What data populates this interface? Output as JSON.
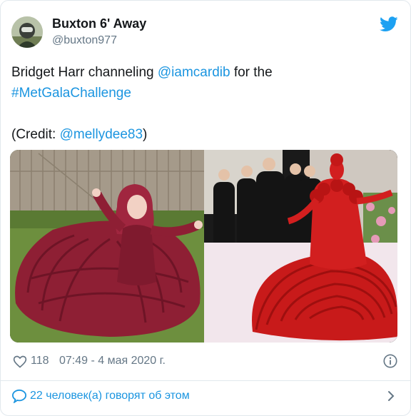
{
  "author": {
    "display_name": "Buxton 6' Away",
    "handle": "@buxton977",
    "avatar_icon": "avatar-photo"
  },
  "brand": {
    "icon": "twitter-bird-icon",
    "color": "#1da1f2"
  },
  "tweet": {
    "text_prefix": "Bridget Harr channeling ",
    "mention_1": "@iamcardib",
    "text_mid": " for the",
    "hashtag": "#MetGalaChallenge",
    "credit_prefix": "(Credit: ",
    "mention_2": "@mellydee83",
    "credit_suffix": ")"
  },
  "media": {
    "left_photo": "child-in-red-blanket-gown-photo",
    "right_photo": "red-carpet-red-gown-photo"
  },
  "meta": {
    "like_icon": "heart-icon",
    "like_count": "118",
    "timestamp": "07:49 - 4 мая 2020 г.",
    "info_icon": "info-icon"
  },
  "footer": {
    "reply_icon": "speech-bubble-icon",
    "text": "22 человек(а) говорят об этом",
    "chevron_icon": "chevron-right-icon"
  },
  "colors": {
    "link": "#1b95e0",
    "secondary_text": "#657786",
    "border": "#e1e8ed"
  }
}
